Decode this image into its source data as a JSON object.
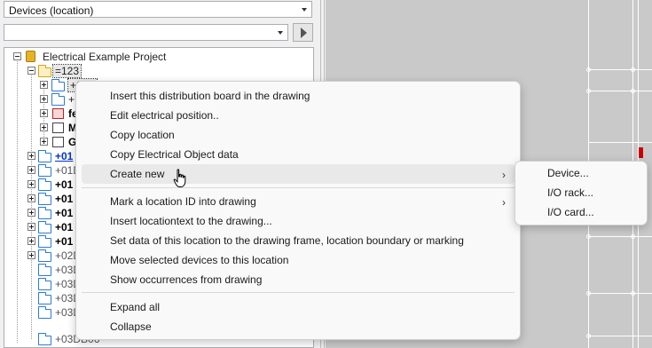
{
  "panel": {
    "location_combo": "Devices (location)",
    "filter_value": ""
  },
  "tree": {
    "root": "Electrical Example Project",
    "level1": "=123",
    "selected_child": "+S01",
    "child2": "+",
    "dev1": "fe",
    "dev2": "M",
    "dev3": "G",
    "rows": [
      {
        "label": "+01",
        "style": "blue"
      },
      {
        "label": "+01D",
        "style": "gray"
      },
      {
        "label": "+01",
        "style": "bold"
      },
      {
        "label": "+01",
        "style": "bold"
      },
      {
        "label": "+01",
        "style": "bold"
      },
      {
        "label": "+01",
        "style": "bold"
      },
      {
        "label": "+01",
        "style": "bold"
      },
      {
        "label": "+02D",
        "style": "gray"
      },
      {
        "label": "+03D",
        "style": "gray"
      },
      {
        "label": "+03D",
        "style": "gray"
      },
      {
        "label": "+03D",
        "style": "gray"
      },
      {
        "label": "+03D",
        "style": "gray"
      },
      {
        "label": "+03DB06",
        "style": "gray"
      }
    ]
  },
  "context_menu": {
    "items": [
      {
        "label": "Insert this distribution board in the drawing"
      },
      {
        "label": "Edit electrical position.."
      },
      {
        "label": "Copy location"
      },
      {
        "label": "Copy Electrical Object data"
      },
      {
        "label": "Create new",
        "submenu": true
      },
      {
        "label": "Mark a location ID into drawing",
        "submenu": true
      },
      {
        "label": "Insert locationtext to the drawing..."
      },
      {
        "label": "Set data of this location to the drawing frame, location boundary or marking"
      },
      {
        "label": "Move selected devices to this location"
      },
      {
        "label": "Show occurrences from drawing"
      },
      {
        "label": "Expand all"
      },
      {
        "label": "Collapse"
      }
    ],
    "chevron": "›"
  },
  "submenu": {
    "items": [
      {
        "label": "Device..."
      },
      {
        "label": "I/O rack..."
      },
      {
        "label": "I/O card..."
      }
    ]
  }
}
